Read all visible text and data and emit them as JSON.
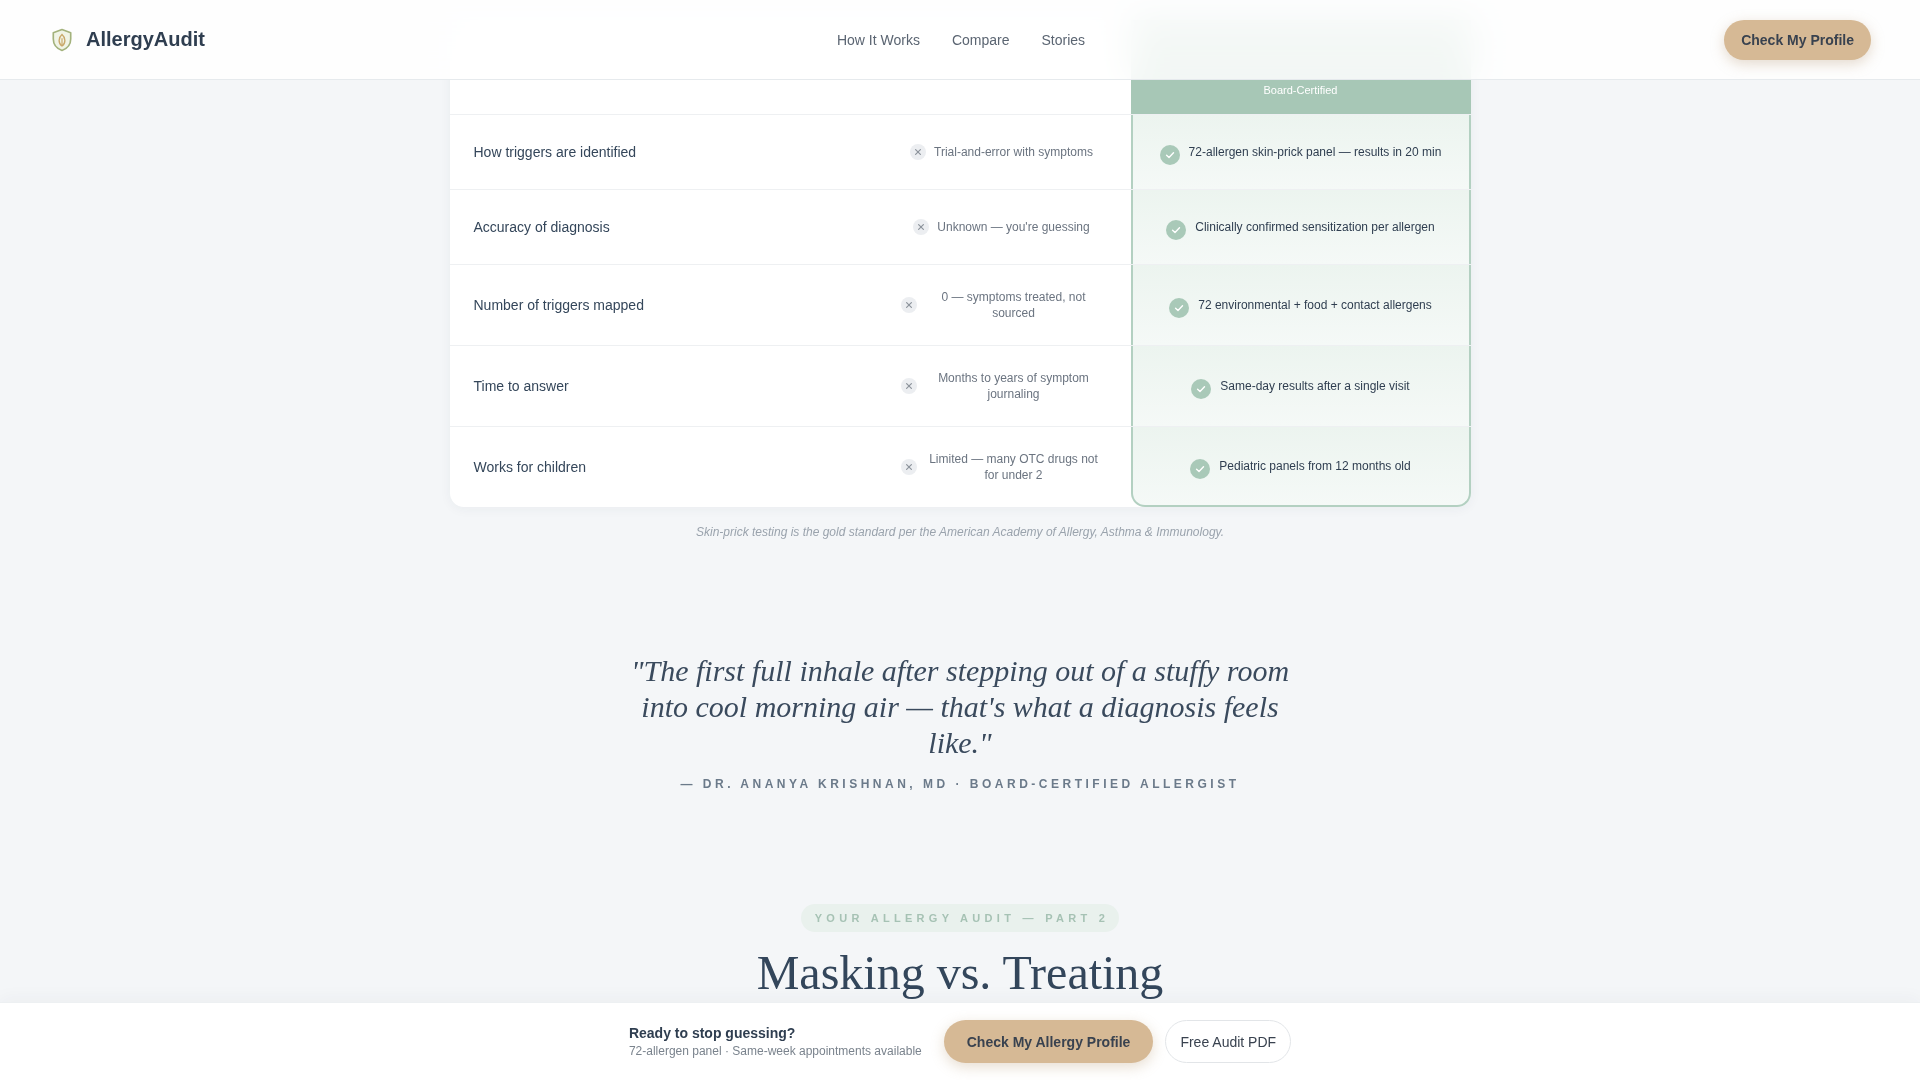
{
  "nav": {
    "brand": "AllergyAudit",
    "links": [
      {
        "label": "How It Works"
      },
      {
        "label": "Compare"
      },
      {
        "label": "Stories"
      }
    ],
    "cta": {
      "label": "Check My Profile"
    }
  },
  "comparison_table": {
    "column_3_header": "Board-Certified",
    "rows": [
      {
        "column_1": "How triggers are identified",
        "column_2": "Trial-and-error with symptoms",
        "column_3": "72-allergen skin-prick panel — results in 20 min"
      },
      {
        "column_1": "Accuracy of diagnosis",
        "column_2": "Unknown — you're guessing",
        "column_3": "Clinically confirmed sensitization per allergen"
      },
      {
        "column_1": "Number of triggers mapped",
        "column_2": "0 — symptoms treated, not sourced",
        "column_3": "72 environmental + food + contact allergens"
      },
      {
        "column_1": "Time to answer",
        "column_2": "Months to years of symptom journaling",
        "column_3": "Same-day results after a single visit"
      },
      {
        "column_1": "Works for children",
        "column_2": "Limited — many OTC drugs not for under 2",
        "column_3": "Pediatric panels from 12 months old"
      }
    ],
    "footnote": "Skin-prick testing is the gold standard per the American Academy of Allergy, Asthma & Immunology."
  },
  "quote": {
    "text": "\"The first full inhale after stepping out of a stuffy room into cool morning air — that's what a diagnosis feels like.\"",
    "attribution": "— DR. ANANYA KRISHNAN, MD · BOARD-CERTIFIED ALLERGIST"
  },
  "section": {
    "eyebrow": "YOUR ALLERGY AUDIT — PART 2",
    "title": "Masking vs. Treating"
  },
  "sticky_bar": {
    "title": "Ready to stop guessing?",
    "subtitle": "72-allergen panel · Same-week appointments available",
    "buttons": [
      {
        "label": "Check My Allergy Profile",
        "kind": "primary"
      },
      {
        "label": "Free Audit PDF",
        "kind": "secondary"
      }
    ]
  }
}
